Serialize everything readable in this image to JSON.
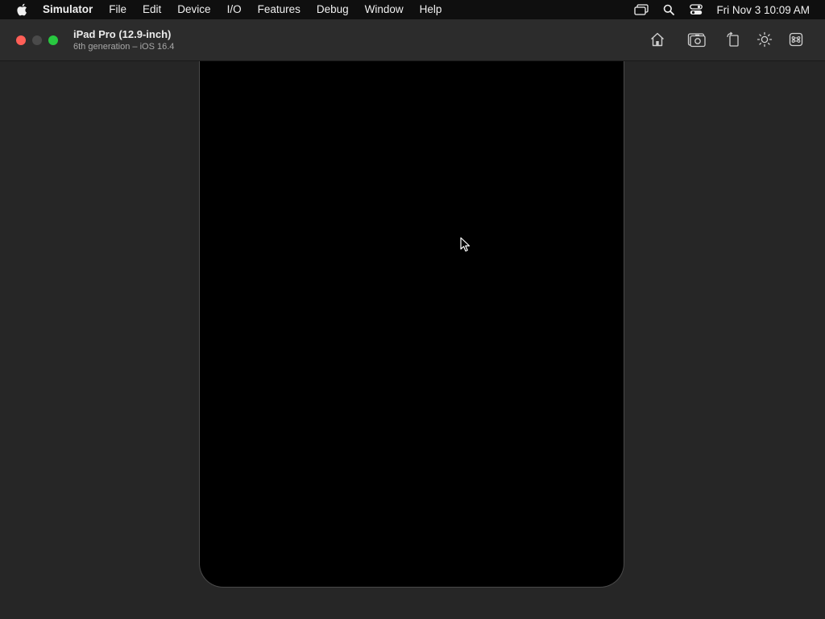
{
  "menubar": {
    "apple_icon": "apple-logo-icon",
    "app_name": "Simulator",
    "items": [
      {
        "label": "File"
      },
      {
        "label": "Edit"
      },
      {
        "label": "Device"
      },
      {
        "label": "I/O"
      },
      {
        "label": "Features"
      },
      {
        "label": "Debug"
      },
      {
        "label": "Window"
      },
      {
        "label": "Help"
      }
    ],
    "status_icons": [
      "screen-mirroring-icon",
      "search-icon",
      "control-center-icon"
    ],
    "clock": "Fri Nov 3  10:09 AM"
  },
  "window": {
    "device_name": "iPad Pro (12.9-inch)",
    "device_subtitle": "6th generation – iOS 16.4",
    "traffic_lights": {
      "close_color": "#ff5f57",
      "minimize_color": "#4a4a4a",
      "zoom_color": "#28c840"
    },
    "toolbar_icons": [
      "home-icon",
      "screenshot-camera-icon",
      "rotate-icon",
      "appearance-sun-icon",
      "command-icon"
    ]
  },
  "device": {
    "screen_state": "black",
    "screen_color": "#000000",
    "frame_color": "#4a4a4a"
  },
  "colors": {
    "menubar_bg": "#0f0f0f",
    "titlebar_bg": "#2c2c2c",
    "desktop_bg": "#262626"
  }
}
